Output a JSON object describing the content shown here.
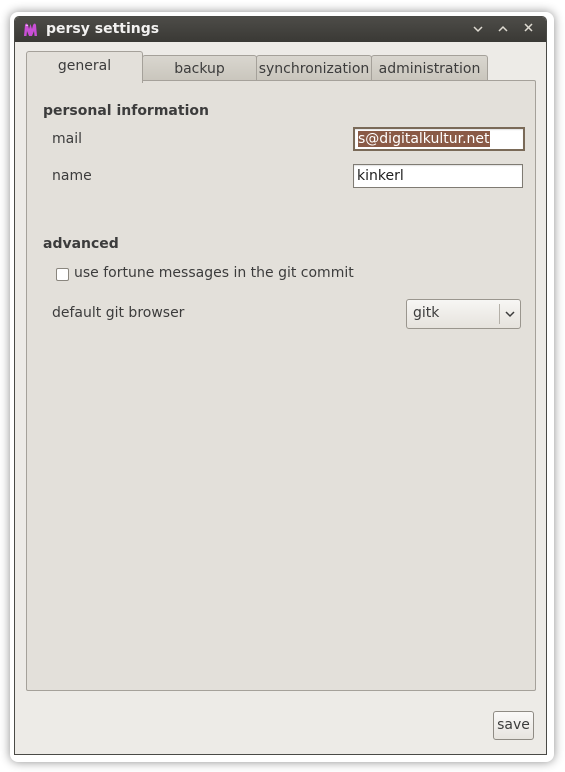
{
  "window": {
    "title": "persy settings",
    "controls": {
      "minimize": "⌄",
      "maximize": "⌃",
      "close": "✕"
    }
  },
  "tabs": [
    {
      "label": "general",
      "active": true
    },
    {
      "label": "backup",
      "active": false
    },
    {
      "label": "synchronization",
      "active": false
    },
    {
      "label": "administration",
      "active": false
    }
  ],
  "personal": {
    "heading": "personal information",
    "mail_label": "mail",
    "mail_value": "s@digitalkultur.net",
    "name_label": "name",
    "name_value": "kinkerl"
  },
  "advanced": {
    "heading": "advanced",
    "fortune_label": "use fortune messages in the git commit",
    "fortune_checked": false,
    "browser_label": "default git browser",
    "browser_value": "gitk"
  },
  "footer": {
    "save_label": "save"
  },
  "colors": {
    "titlebar": "#3f3e3a",
    "window_bg": "#edebe7",
    "selection": "#8a5a46",
    "app_icon": "#c94fd6"
  },
  "icons": {
    "app": "persy-app-icon",
    "combo_arrow": "chevron-down-icon"
  }
}
